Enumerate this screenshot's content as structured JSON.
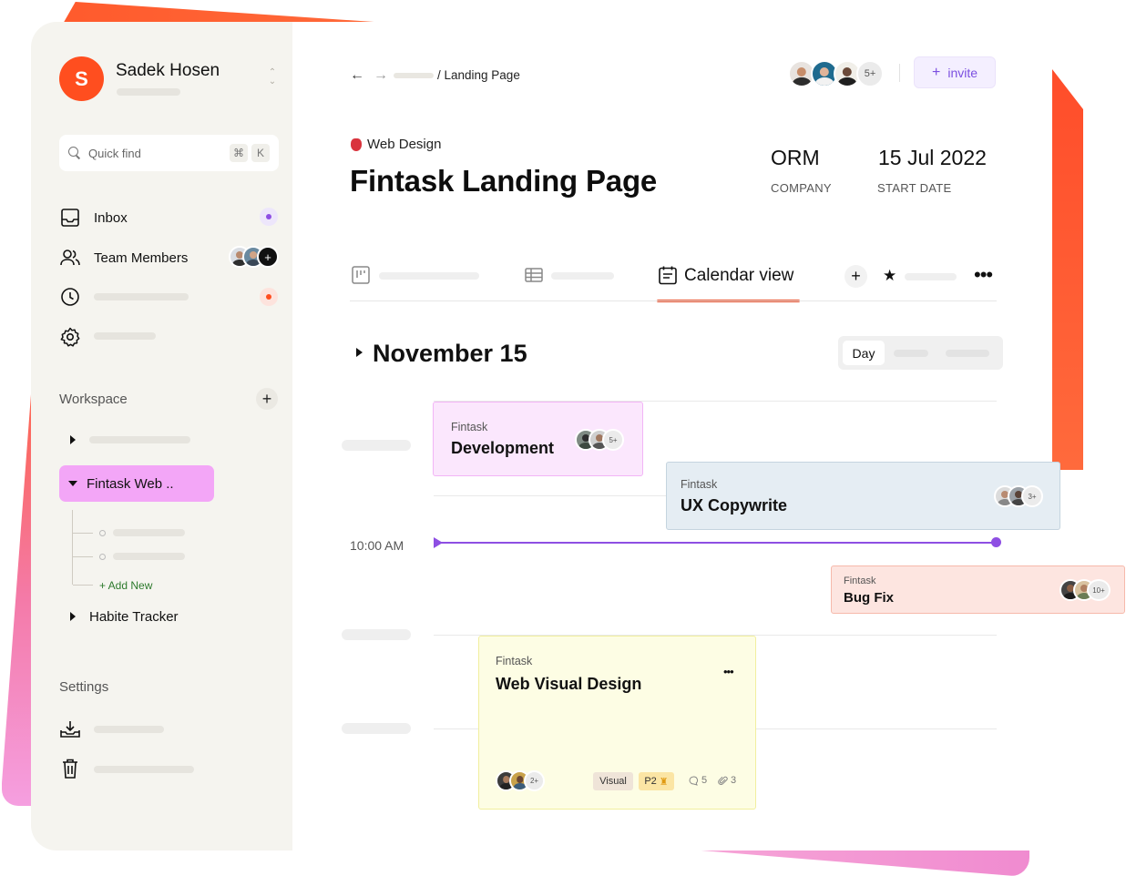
{
  "user": {
    "name": "Sadek Hosen",
    "initial": "S"
  },
  "search": {
    "placeholder": "Quick find",
    "kbd_cmd": "⌘",
    "kbd_key": "K"
  },
  "nav": {
    "inbox": "Inbox",
    "team_members": "Team Members"
  },
  "workspace": {
    "title": "Workspace",
    "active_item": "Fintask Web ..",
    "add_new": "+ Add New",
    "habit_tracker": "Habite Tracker"
  },
  "settings": {
    "title": "Settings"
  },
  "breadcrumb": {
    "current": "/ Landing Page"
  },
  "collaborators": {
    "more": "5+"
  },
  "invite": {
    "label": "invite",
    "icon": "+"
  },
  "project": {
    "tag": "Web Design",
    "title": "Fintask Landing Page",
    "company_value": "ORM",
    "company_label": "COMPANY",
    "start_date_value": "15 Jul 2022",
    "start_date_label": "START DATE"
  },
  "tabs": {
    "active": "Calendar view"
  },
  "calendar": {
    "month_label": "November 15",
    "view_day": "Day",
    "time_label": "10:00 AM"
  },
  "events": [
    {
      "project": "Fintask",
      "title": "Development",
      "more": "5+"
    },
    {
      "project": "Fintask",
      "title": "UX Copywrite",
      "more": "3+"
    },
    {
      "project": "Fintask",
      "title": "Bug Fix",
      "more": "10+"
    },
    {
      "project": "Fintask",
      "title": "Web Visual Design",
      "more": "2+",
      "label": "Visual",
      "priority": "P2",
      "comments": "5",
      "attachments": "3",
      "menu": "•••"
    }
  ],
  "colors": {
    "accent_orange": "#ff4e1f",
    "accent_purple": "#8e4fe3",
    "active_workspace": "#f3a6f7",
    "card_pink": "#fbe7fd",
    "card_blue": "#e5edf3",
    "card_peach": "#fde5e0",
    "card_yellow": "#fdfde4"
  }
}
